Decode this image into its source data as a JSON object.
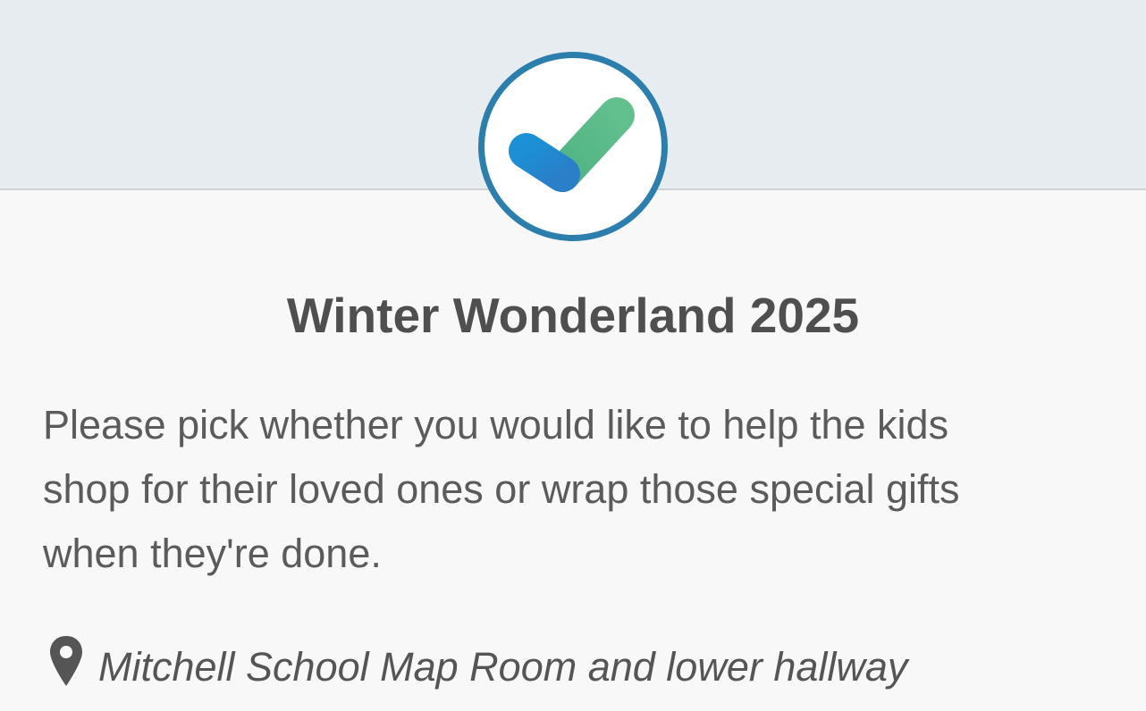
{
  "event": {
    "title": "Winter Wonderland 2025",
    "description": "Please pick whether you would like to help the kids shop for their loved ones or wrap those special gifts when they're done.",
    "location": "Mitchell School Map Room and lower hallway"
  },
  "icons": {
    "logo": "checkmark-logo-icon",
    "location": "map-pin-icon"
  },
  "colors": {
    "header_background": "#e7ecf0",
    "logo_ring": "#2c7fad",
    "check_blue": "#1f8ed0",
    "check_green": "#5bb98a",
    "title_text": "#4f4f4f",
    "body_text": "#5b5b5b"
  }
}
